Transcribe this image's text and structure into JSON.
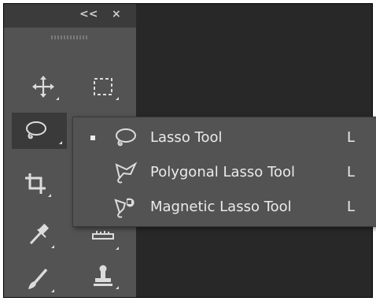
{
  "header": {
    "collapse_label": "<<",
    "close_label": "×"
  },
  "tools": [
    {
      "id": "move",
      "icon": "move-icon"
    },
    {
      "id": "marquee",
      "icon": "rectangular-marquee-icon"
    },
    {
      "id": "lasso",
      "icon": "lasso-icon",
      "active": true
    },
    {
      "id": "crop",
      "icon": "crop-icon"
    },
    {
      "id": "eyedropper",
      "icon": "eyedropper-icon"
    },
    {
      "id": "ruler",
      "icon": "ruler-icon"
    },
    {
      "id": "brush",
      "icon": "brush-icon"
    },
    {
      "id": "stamp",
      "icon": "clone-stamp-icon"
    }
  ],
  "flyout": {
    "items": [
      {
        "label": "Lasso Tool",
        "shortcut": "L",
        "icon": "lasso-icon",
        "selected": true
      },
      {
        "label": "Polygonal Lasso Tool",
        "shortcut": "L",
        "icon": "polygonal-lasso-icon",
        "selected": false
      },
      {
        "label": "Magnetic Lasso Tool",
        "shortcut": "L",
        "icon": "magnetic-lasso-icon",
        "selected": false
      }
    ]
  },
  "colors": {
    "toolbar": "#535353",
    "header": "#3b3b3b",
    "canvas": "#282828",
    "icon": "#dcdcdc"
  }
}
